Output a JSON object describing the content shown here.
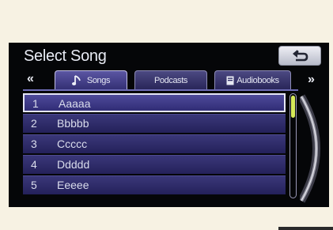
{
  "header": {
    "title": "Select Song",
    "back_icon": "return-arrow-icon"
  },
  "nav": {
    "prev_label": "«",
    "next_label": "»"
  },
  "tabs": [
    {
      "label": "Songs",
      "icon": "music-note-icon",
      "active": true
    },
    {
      "label": "Podcasts",
      "active": false
    },
    {
      "label": "Audiobooks",
      "icon": "book-icon",
      "active": false
    }
  ],
  "songs": [
    {
      "num": "1",
      "name": "Aaaaa",
      "selected": true
    },
    {
      "num": "2",
      "name": "Bbbbb"
    },
    {
      "num": "3",
      "name": "Ccccc"
    },
    {
      "num": "4",
      "name": "Ddddd"
    },
    {
      "num": "5",
      "name": "Eeeee"
    }
  ],
  "colors": {
    "accent": "#d7ea59",
    "list_bg": "#2a275f",
    "screen_bg": "#050608"
  }
}
